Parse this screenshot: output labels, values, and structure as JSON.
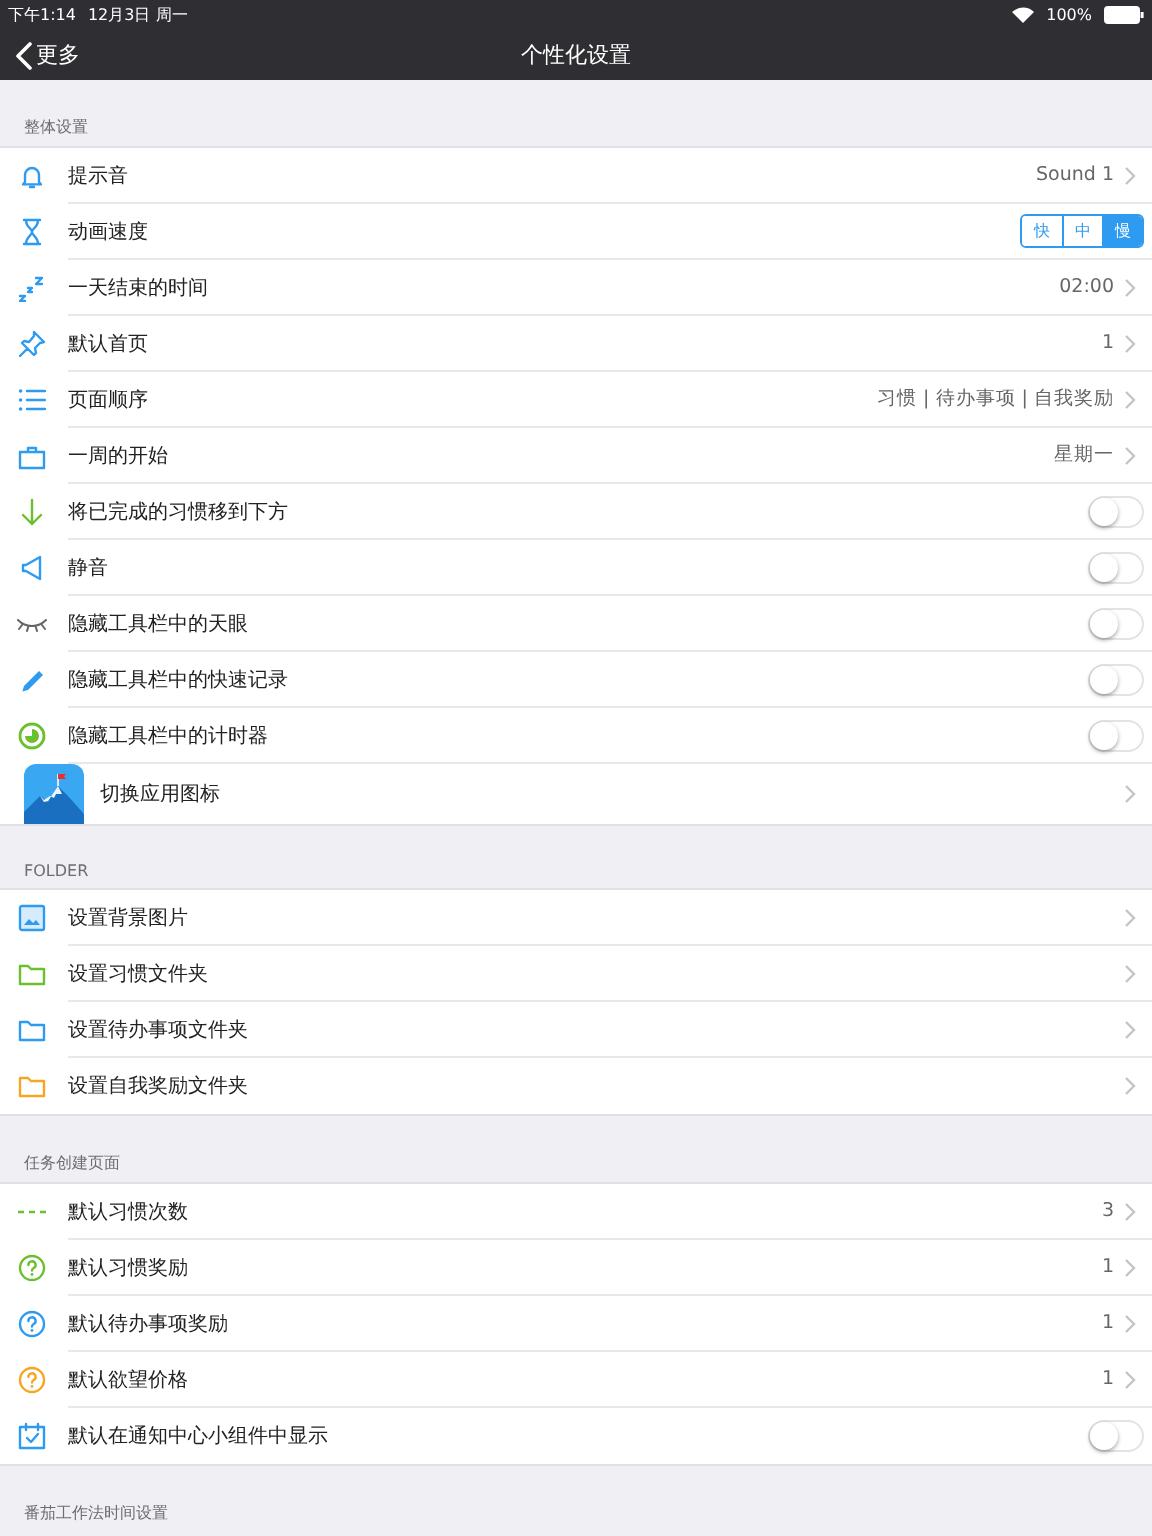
{
  "status_bar": {
    "time": "下午1:14",
    "date": "12月3日 周一",
    "battery": "100%"
  },
  "nav": {
    "back": "更多",
    "title": "个性化设置"
  },
  "sections": [
    {
      "header": "整体设置",
      "rows": [
        {
          "kind": "value",
          "label": "提示音",
          "value": "Sound 1"
        },
        {
          "kind": "segmented",
          "label": "动画速度",
          "options": [
            {
              "label": "快",
              "selected": false
            },
            {
              "label": "中",
              "selected": false
            },
            {
              "label": "慢",
              "selected": true
            }
          ]
        },
        {
          "kind": "value",
          "label": "一天结束的时间",
          "value": "02:00"
        },
        {
          "kind": "value",
          "label": "默认首页",
          "value": "1"
        },
        {
          "kind": "value",
          "label": "页面顺序",
          "value": "习惯 | 待办事项 | 自我奖励"
        },
        {
          "kind": "value",
          "label": "一周的开始",
          "value": "星期一"
        },
        {
          "kind": "toggle",
          "label": "将已完成的习惯移到下方",
          "on": false
        },
        {
          "kind": "toggle",
          "label": "静音",
          "on": false
        },
        {
          "kind": "toggle",
          "label": "隐藏工具栏中的天眼",
          "on": false
        },
        {
          "kind": "toggle",
          "label": "隐藏工具栏中的快速记录",
          "on": false
        },
        {
          "kind": "toggle",
          "label": "隐藏工具栏中的计时器",
          "on": false
        },
        {
          "kind": "app",
          "label": "切换应用图标"
        }
      ]
    },
    {
      "header": "FOLDER",
      "rows": [
        {
          "kind": "link",
          "label": "设置背景图片"
        },
        {
          "kind": "link",
          "label": "设置习惯文件夹",
          "color": "#6cbf2e"
        },
        {
          "kind": "link",
          "label": "设置待办事项文件夹",
          "color": "#2f9bf0"
        },
        {
          "kind": "link",
          "label": "设置自我奖励文件夹",
          "color": "#f5a623"
        }
      ]
    },
    {
      "header": "任务创建页面",
      "rows": [
        {
          "kind": "value",
          "label": "默认习惯次数",
          "value": "3"
        },
        {
          "kind": "value",
          "label": "默认习惯奖励",
          "value": "1",
          "color": "#6cbf2e"
        },
        {
          "kind": "value",
          "label": "默认待办事项奖励",
          "value": "1",
          "color": "#2f9bf0"
        },
        {
          "kind": "value",
          "label": "默认欲望价格",
          "value": "1",
          "color": "#f5a623"
        },
        {
          "kind": "toggle",
          "label": "默认在通知中心小组件中显示",
          "on": false
        }
      ]
    },
    {
      "header": "番茄工作法时间设置"
    }
  ]
}
